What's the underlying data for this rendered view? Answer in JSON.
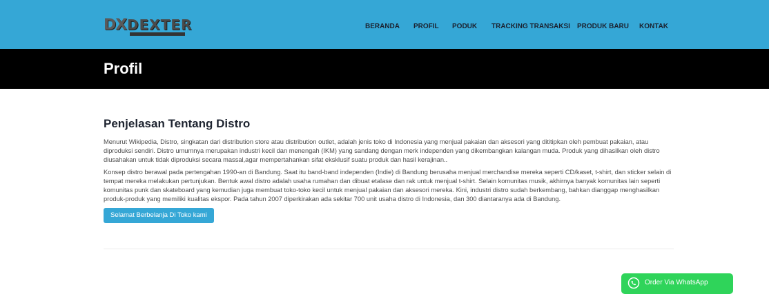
{
  "brand": {
    "mark": "DX",
    "name": "DEXTER"
  },
  "nav": {
    "items": [
      {
        "label": "BERANDA"
      },
      {
        "label": "PROFIL"
      },
      {
        "label": "PODUK"
      },
      {
        "label": "TRACKING TRANSAKSI"
      },
      {
        "label": "PRODUK BARU"
      },
      {
        "label": "KONTAK"
      }
    ]
  },
  "page": {
    "title": "Profil"
  },
  "article": {
    "heading": "Penjelasan Tentang Distro",
    "paragraph1": "Menurut Wikipedia, Distro, singkatan dari distribution store atau distribution outlet, adalah jenis toko di Indonesia yang menjual pakaian dan aksesori yang dititipkan oleh pembuat pakaian, atau diproduksi sendiri. Distro umumnya merupakan industri kecil dan menengah (IKM) yang sandang dengan merk independen yang dikembangkan kalangan muda. Produk yang dihasilkan oleh distro diusahakan untuk tidak diproduksi secara massal,agar mempertahankan sifat eksklusif suatu produk dan hasil kerajinan..",
    "paragraph2": "Konsep distro berawal pada pertengahan 1990-an di Bandung. Saat itu band-band independen (Indie) di Bandung berusaha menjual merchandise mereka seperti CD/kaset, t-shirt, dan sticker selain di tempat mereka melakukan pertunjukan. Bentuk awal distro adalah usaha rumahan dan dibuat etalase dan rak untuk menjual t-shirt. Selain komunitas musik, akhirnya banyak komunitas lain seperti komunitas punk dan skateboard yang kemudian juga membuat toko-toko kecil untuk menjual pakaian dan aksesori mereka. Kini, industri distro sudah berkembang, bahkan dianggap menghasilkan produk-produk yang memiliki kualitas ekspor. Pada tahun 2007 diperkirakan ada sekitar 700 unit usaha distro di Indonesia, dan 300 diantaranya ada di Bandung.",
    "button_label": "Selamat Berbelanja Di Toko kami"
  },
  "whatsapp": {
    "label": "Order Via WhatsApp",
    "icon": "whatsapp-icon"
  },
  "colors": {
    "navbar": "#35a7d6",
    "banner": "#000000",
    "whatsapp": "#2fd45a"
  }
}
